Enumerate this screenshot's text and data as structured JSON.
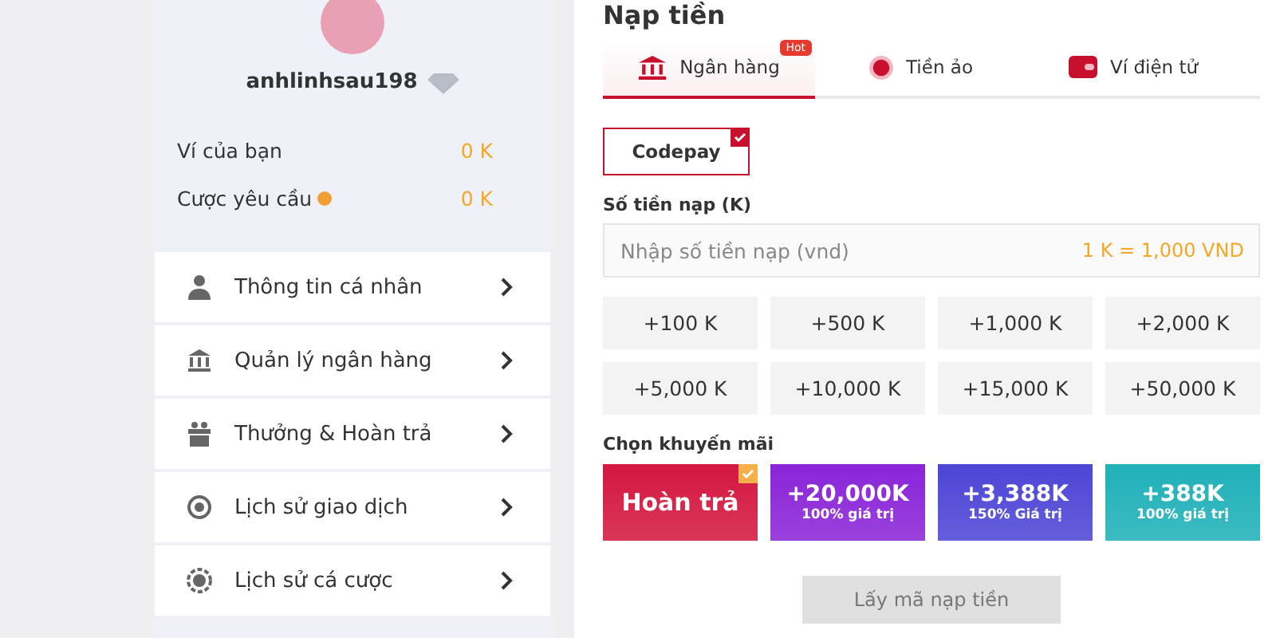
{
  "profile": {
    "username": "anhlinhsau198",
    "wallet_label": "Ví của bạn",
    "wallet_value": "0 K",
    "bet_label": "Cược yêu cầu",
    "bet_value": "0 K"
  },
  "menu": [
    {
      "label": "Thông tin cá nhân",
      "kind": "user"
    },
    {
      "label": "Quản lý ngân hàng",
      "kind": "bank"
    },
    {
      "label": "Thưởng & Hoàn trả",
      "kind": "gift"
    },
    {
      "label": "Lịch sử giao dịch",
      "kind": "history"
    },
    {
      "label": "Lịch sử cá cược",
      "kind": "coin"
    }
  ],
  "title": "Nạp tiền",
  "tabs": [
    {
      "label": "Ngân hàng",
      "kind": "bank",
      "selected": true,
      "badge": "Hot"
    },
    {
      "label": "Tiền ảo",
      "kind": "crypto",
      "selected": false
    },
    {
      "label": "Ví điện tử",
      "kind": "wallet",
      "selected": false
    }
  ],
  "methods": [
    {
      "label": "Codepay",
      "checked": true
    }
  ],
  "amount": {
    "label": "Số tiền nạp (K)",
    "placeholder": "Nhập số tiền nạp (vnd)",
    "rate": "1 K = 1,000 VND"
  },
  "presets": [
    "+100 K",
    "+500 K",
    "+1,000 K",
    "+2,000 K",
    "+5,000 K",
    "+10,000 K",
    "+15,000 K",
    "+50,000 K"
  ],
  "promo_label": "Chọn khuyến mãi",
  "promos": [
    {
      "title": "Hoàn trả",
      "color": "#d4173f",
      "selected": true
    },
    {
      "title": "+20,000K",
      "subtitle": "100% giá trị",
      "color": "#8a24d8",
      "selected": false
    },
    {
      "title": "+3,388K",
      "subtitle": "150% Giá trị",
      "color": "#4d45d6",
      "selected": false
    },
    {
      "title": "+388K",
      "subtitle": "100% giá trị",
      "color": "#1fb0b8",
      "selected": false
    }
  ],
  "submit": "Lấy mã nạp tiền"
}
